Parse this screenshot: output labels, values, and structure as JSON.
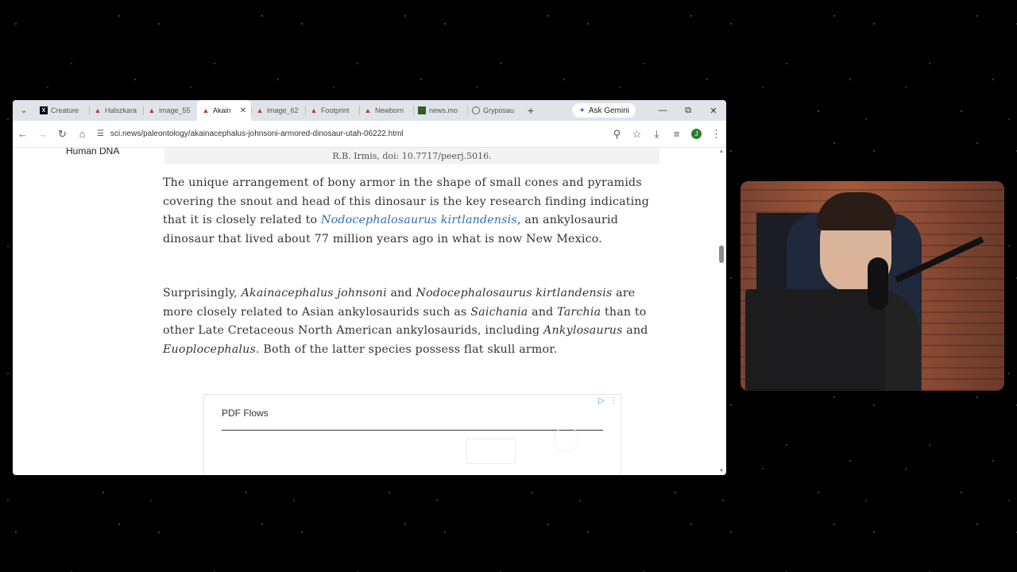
{
  "tabs": [
    {
      "title": "Creature",
      "icon": "x-logo-icon",
      "active": false
    },
    {
      "title": "Halszkara",
      "icon": "sci-news-icon",
      "active": false
    },
    {
      "title": "image_55",
      "icon": "sci-news-icon",
      "active": false
    },
    {
      "title": "Akain",
      "icon": "sci-news-icon",
      "active": true
    },
    {
      "title": "image_62",
      "icon": "sci-news-icon",
      "active": false
    },
    {
      "title": "Footprint",
      "icon": "sci-news-icon",
      "active": false
    },
    {
      "title": "Newborn",
      "icon": "sci-news-icon",
      "active": false
    },
    {
      "title": "news.mo",
      "icon": "news-image-icon",
      "active": false
    },
    {
      "title": "Gryposau",
      "icon": "globe-icon",
      "active": false
    }
  ],
  "ask_gemini": "Ask Gemini",
  "address_bar": {
    "url": "sci.news/paleontology/akainacephalus-johnsoni-armored-dinosaur-utah-06222.html"
  },
  "avatar_letter": "J",
  "sidebar_label": "Human DNA",
  "figure_caption": "R.B. Irmis, doi: 10.7717/peerj.5016.",
  "paragraph1": {
    "text_a": "The unique arrangement of bony armor in the shape of small cones and pyramids covering the snout and head of this dinosaur is the key research finding indicating that it is closely related to ",
    "link": "Nodocephalosaurus kirtlandensis",
    "text_b": ", an ankylosaurid dinosaur that lived about 77 million years ago in what is now New Mexico."
  },
  "paragraph2": {
    "t1": "Surprisingly, ",
    "i1": "Akainacephalus johnsoni",
    "t2": " and ",
    "i2": "Nodocephalosaurus kirtlandensis",
    "t3": " are more closely related to Asian ankylosaurids such as ",
    "i3": "Saichania",
    "t4": " and ",
    "i4": "Tarchia",
    "t5": " than to other Late Cretaceous North American ankylosaurids, including ",
    "i5": "Ankylosaurus",
    "t6": " and ",
    "i6": "Euoplocephalus",
    "t7": ". Both of the latter species possess flat skull armor."
  },
  "ad": {
    "title": "PDF Flows"
  },
  "colors": {
    "link": "#2f6fb6",
    "tabbar": "#dfe3ea",
    "background": "#000000"
  }
}
